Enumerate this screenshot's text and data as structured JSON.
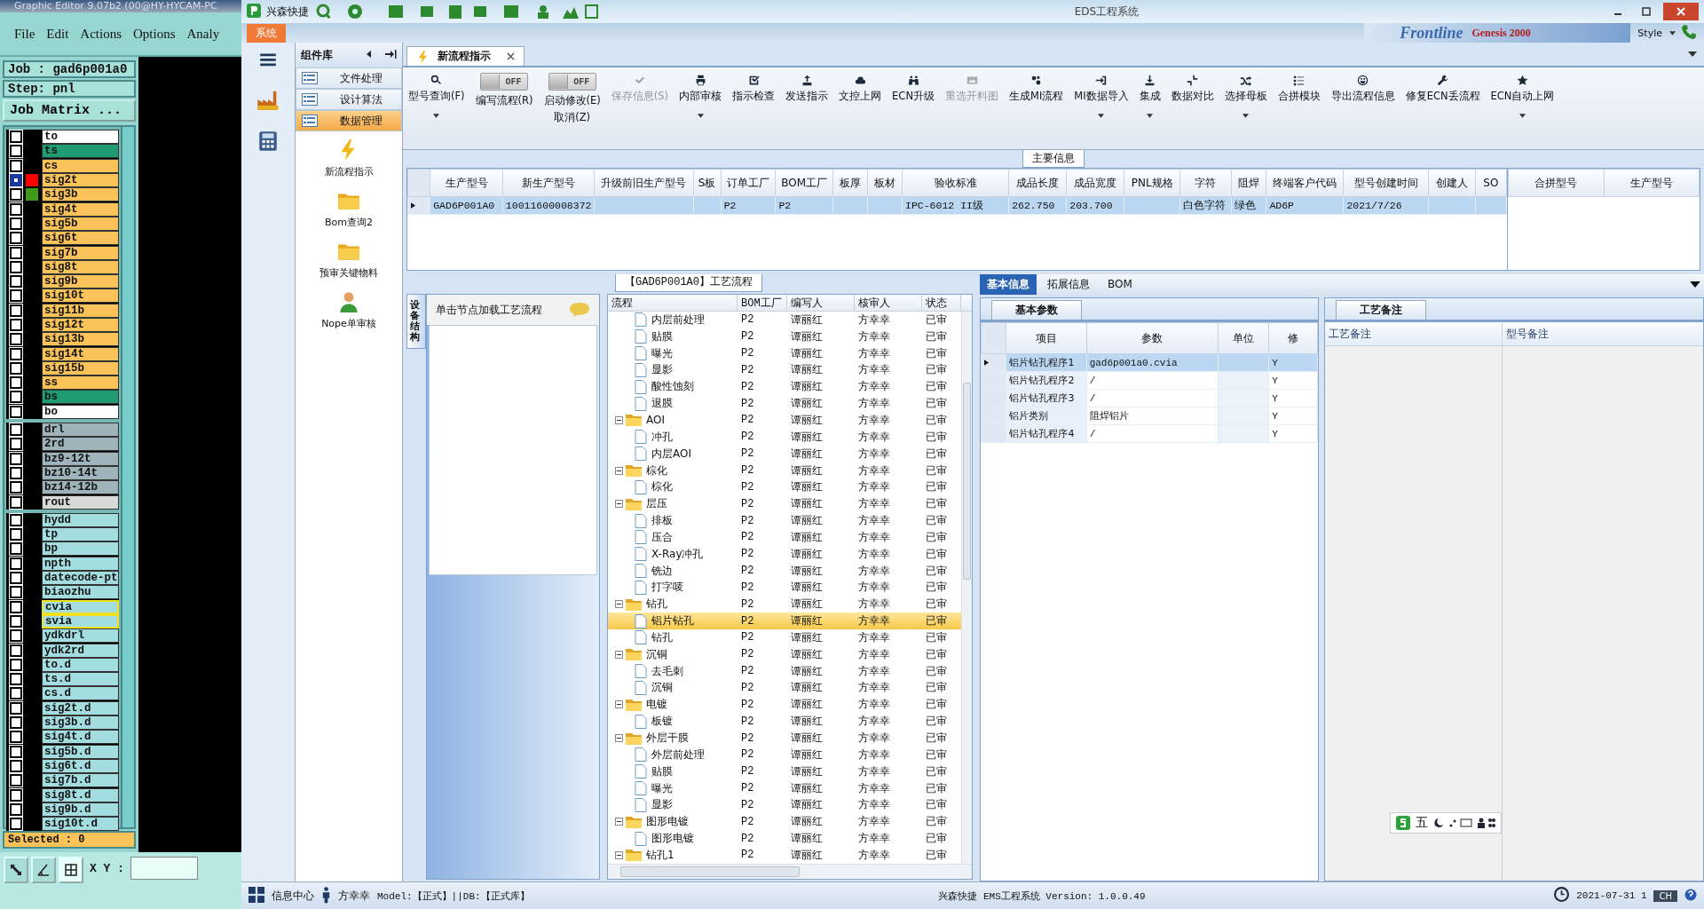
{
  "genesis": {
    "title": "Graphic Editor 9.07b2 (00@HY-HYCAM-PC",
    "menu": [
      "File",
      "Edit",
      "Actions",
      "Options",
      "Analy"
    ],
    "job": "Job : gad6p001a0",
    "step": "Step: pnl",
    "job_matrix": "Job Matrix ...",
    "layer_groups": [
      [
        {
          "name": "to",
          "color": "#ffffff",
          "checked": false,
          "highlighted": false
        },
        {
          "name": "ts",
          "color": "#1f9c72",
          "checked": false,
          "highlighted": false
        },
        {
          "name": "cs",
          "color": "#f9c35a",
          "checked": false,
          "highlighted": false
        },
        {
          "name": "sig2t",
          "color": "#f9c35a",
          "swatch": {
            "color": "#ff0000"
          },
          "checked": true,
          "highlighted": false
        },
        {
          "name": "sig3b",
          "color": "#f9c35a",
          "swatch": {
            "color": "#3f9a1c"
          },
          "checked": false,
          "highlighted": false
        },
        {
          "name": "sig4t",
          "color": "#f9c35a",
          "checked": false,
          "highlighted": false
        },
        {
          "name": "sig5b",
          "color": "#f9c35a",
          "checked": false,
          "highlighted": false
        },
        {
          "name": "sig6t",
          "color": "#f9c35a",
          "checked": false,
          "highlighted": false
        },
        {
          "name": "sig7b",
          "color": "#f9c35a",
          "checked": false,
          "highlighted": false
        },
        {
          "name": "sig8t",
          "color": "#f9c35a",
          "checked": false,
          "highlighted": false
        },
        {
          "name": "sig9b",
          "color": "#f9c35a",
          "checked": false,
          "highlighted": false
        },
        {
          "name": "sig10t",
          "color": "#f9c35a",
          "checked": false,
          "highlighted": false
        },
        {
          "name": "sig11b",
          "color": "#f9c35a",
          "checked": false,
          "highlighted": false
        },
        {
          "name": "sig12t",
          "color": "#f9c35a",
          "checked": false,
          "highlighted": false
        },
        {
          "name": "sig13b",
          "color": "#f9c35a",
          "checked": false,
          "highlighted": false
        },
        {
          "name": "sig14t",
          "color": "#f9c35a",
          "checked": false,
          "highlighted": false
        },
        {
          "name": "sig15b",
          "color": "#f9c35a",
          "checked": false,
          "highlighted": false
        },
        {
          "name": "ss",
          "color": "#f9c35a",
          "checked": false,
          "highlighted": false
        },
        {
          "name": "bs",
          "color": "#1f9c72",
          "checked": false,
          "highlighted": false
        },
        {
          "name": "bo",
          "color": "#ffffff",
          "checked": false,
          "highlighted": false
        }
      ],
      [
        {
          "name": "drl",
          "color": "#9fb3bb",
          "checked": false,
          "highlighted": false
        },
        {
          "name": "2rd",
          "color": "#9fb3bb",
          "checked": false,
          "highlighted": false
        },
        {
          "name": "bz9-12t",
          "color": "#9fb3bb",
          "checked": false,
          "highlighted": false
        },
        {
          "name": "bz10-14t",
          "color": "#9fb3bb",
          "checked": false,
          "highlighted": false
        },
        {
          "name": "bz14-12b",
          "color": "#9fb3bb",
          "checked": false,
          "highlighted": false
        },
        {
          "name": "rout",
          "color": "#d9d9d9",
          "checked": false,
          "highlighted": false
        }
      ],
      [
        {
          "name": "hydd",
          "color": "#a3dde0",
          "checked": false,
          "highlighted": false
        },
        {
          "name": "tp",
          "color": "#a3dde0",
          "checked": false,
          "highlighted": false
        },
        {
          "name": "bp",
          "color": "#a3dde0",
          "checked": false,
          "highlighted": false
        },
        {
          "name": "npth",
          "color": "#a3dde0",
          "checked": false,
          "highlighted": false
        },
        {
          "name": "datecode-pt",
          "color": "#a3dde0",
          "checked": false,
          "highlighted": false
        },
        {
          "name": "biaozhu",
          "color": "#a3dde0",
          "checked": false,
          "highlighted": false
        },
        {
          "name": "cvia",
          "color": "#a3dde0",
          "checked": false,
          "highlighted": true
        },
        {
          "name": "svia",
          "color": "#a3dde0",
          "checked": false,
          "highlighted": true
        },
        {
          "name": "ydkdrl",
          "color": "#a3dde0",
          "checked": false,
          "highlighted": false
        },
        {
          "name": "ydk2rd",
          "color": "#a3dde0",
          "checked": false,
          "highlighted": false
        },
        {
          "name": "to.d",
          "color": "#a3dde0",
          "checked": false,
          "highlighted": false
        },
        {
          "name": "ts.d",
          "color": "#a3dde0",
          "checked": false,
          "highlighted": false
        },
        {
          "name": "cs.d",
          "color": "#a3dde0",
          "checked": false,
          "highlighted": false
        },
        {
          "name": "sig2t.d",
          "color": "#a3dde0",
          "checked": false,
          "highlighted": false
        },
        {
          "name": "sig3b.d",
          "color": "#a3dde0",
          "checked": false,
          "highlighted": false
        },
        {
          "name": "sig4t.d",
          "color": "#a3dde0",
          "checked": false,
          "highlighted": false
        },
        {
          "name": "sig5b.d",
          "color": "#a3dde0",
          "checked": false,
          "highlighted": false
        },
        {
          "name": "sig6t.d",
          "color": "#a3dde0",
          "checked": false,
          "highlighted": false
        },
        {
          "name": "sig7b.d",
          "color": "#a3dde0",
          "checked": false,
          "highlighted": false
        },
        {
          "name": "sig8t.d",
          "color": "#a3dde0",
          "checked": false,
          "highlighted": false
        },
        {
          "name": "sig9b.d",
          "color": "#a3dde0",
          "checked": false,
          "highlighted": false
        },
        {
          "name": "sig10t.d",
          "color": "#a3dde0",
          "checked": false,
          "highlighted": false
        }
      ]
    ],
    "selected": "Selected : 0",
    "xy_label": "X Y :"
  },
  "ems": {
    "app_name": "兴森快捷",
    "title": "EDS工程系统",
    "menu_tab": "系统",
    "banner": [
      "Frontline",
      "Genesis 2000"
    ],
    "style": "Style",
    "library": {
      "title": "组件库",
      "categories": [
        {
          "label": "文件处理",
          "selected": false
        },
        {
          "label": "设计算法",
          "selected": false
        },
        {
          "label": "数据管理",
          "selected": true
        }
      ],
      "tools": [
        {
          "label": "新流程指示",
          "kind": "lightning"
        },
        {
          "label": "Bom查询2",
          "kind": "folder"
        },
        {
          "label": "预审关键物料",
          "kind": "folder"
        },
        {
          "label": "Nope单审核",
          "kind": "person"
        }
      ]
    },
    "doc_tab": "新流程指示",
    "toolbar": [
      {
        "kind": "button",
        "label": "型号查询(F)",
        "dropdown": true,
        "disabled": false
      },
      {
        "kind": "toggle",
        "state": "OFF",
        "on": false,
        "label": "编写流程(R)"
      },
      {
        "kind": "toggle",
        "state": "OFF",
        "on": false,
        "label": "启动修改(E)",
        "label2": "取消(Z)"
      },
      {
        "kind": "button",
        "label": "保存信息(S)",
        "dropdown": false,
        "disabled": true
      },
      {
        "kind": "button",
        "label": "内部审核",
        "dropdown": true,
        "disabled": false
      },
      {
        "kind": "button",
        "label": "指示检查",
        "dropdown": false,
        "disabled": false
      },
      {
        "kind": "button",
        "label": "发送指示",
        "dropdown": false,
        "disabled": false
      },
      {
        "kind": "button",
        "label": "文控上网",
        "dropdown": false,
        "disabled": false
      },
      {
        "kind": "button",
        "label": "ECN升级",
        "dropdown": false,
        "disabled": false
      },
      {
        "kind": "button",
        "label": "重选开料图",
        "dropdown": false,
        "disabled": true
      },
      {
        "kind": "button",
        "label": "生成MI流程",
        "dropdown": false,
        "disabled": false
      },
      {
        "kind": "button",
        "label": "MI数据导入",
        "dropdown": true,
        "disabled": false
      },
      {
        "kind": "button",
        "label": "集成",
        "dropdown": true,
        "disabled": false
      },
      {
        "kind": "button",
        "label": "数据对比",
        "dropdown": false,
        "disabled": false
      },
      {
        "kind": "button",
        "label": "选择母板",
        "dropdown": true,
        "disabled": false
      },
      {
        "kind": "button",
        "label": "合拼模块",
        "dropdown": false,
        "disabled": false
      },
      {
        "kind": "button",
        "label": "导出流程信息",
        "dropdown": false,
        "disabled": false
      },
      {
        "kind": "button",
        "label": "修复ECN丢流程",
        "dropdown": false,
        "disabled": false
      },
      {
        "kind": "button",
        "label": "ECN自动上网",
        "dropdown": true,
        "disabled": false
      }
    ],
    "main_info": {
      "title": "主要信息",
      "columns": [
        "生产型号",
        "新生产型号",
        "升级前旧生产型号",
        "S板",
        "订单工厂",
        "BOM工厂",
        "板厚",
        "板材",
        "验收标准",
        "成品长度",
        "成品宽度",
        "PNL规格",
        "字符",
        "阻焊",
        "终端客户代码",
        "型号创建时间",
        "创建人",
        "SO"
      ],
      "rows": [
        {
          "selected": true,
          "cells": [
            "GAD6P001A0",
            "10011600008372",
            null,
            null,
            "P2",
            "P2",
            null,
            null,
            "IPC-6012 II级",
            "262.750",
            "203.700",
            null,
            "白色字符",
            "绿色",
            "AD6P",
            "2021/7/26",
            null,
            null
          ]
        }
      ],
      "side_columns": [
        "合拼型号",
        "生产型号"
      ]
    },
    "process": {
      "title": "【GAD6P001A0】工艺流程",
      "side_tab": "设备结构",
      "hint": "单击节点加载工艺流程",
      "columns": [
        "流程",
        "BOM工厂",
        "编写人",
        "核审人",
        "状态"
      ],
      "tree": [
        {
          "kind": "hidden_parent",
          "children": [
            {
              "kind": "file",
              "label": "内层前处理",
              "selected": false,
              "cells": [
                "P2",
                "谭丽红",
                "方幸幸",
                "已审"
              ]
            },
            {
              "kind": "file",
              "label": "贴膜",
              "selected": false,
              "cells": [
                "P2",
                "谭丽红",
                "方幸幸",
                "已审"
              ]
            },
            {
              "kind": "file",
              "label": "曝光",
              "selected": false,
              "cells": [
                "P2",
                "谭丽红",
                "方幸幸",
                "已审"
              ]
            },
            {
              "kind": "file",
              "label": "显影",
              "selected": false,
              "cells": [
                "P2",
                "谭丽红",
                "方幸幸",
                "已审"
              ]
            },
            {
              "kind": "file",
              "label": "酸性蚀刻",
              "selected": false,
              "cells": [
                "P2",
                "谭丽红",
                "方幸幸",
                "已审"
              ]
            },
            {
              "kind": "file",
              "label": "退膜",
              "selected": false,
              "cells": [
                "P2",
                "谭丽红",
                "方幸幸",
                "已审"
              ]
            }
          ]
        },
        {
          "kind": "folder",
          "label": "AOI",
          "expanded": true,
          "selected": false,
          "cells": [
            "P2",
            "谭丽红",
            "方幸幸",
            "已审"
          ],
          "children": [
            {
              "kind": "file",
              "label": "冲孔",
              "selected": false,
              "cells": [
                "P2",
                "谭丽红",
                "方幸幸",
                "已审"
              ]
            },
            {
              "kind": "file",
              "label": "内层AOI",
              "selected": false,
              "cells": [
                "P2",
                "谭丽红",
                "方幸幸",
                "已审"
              ]
            }
          ]
        },
        {
          "kind": "folder",
          "label": "棕化",
          "expanded": true,
          "selected": false,
          "cells": [
            "P2",
            "谭丽红",
            "方幸幸",
            "已审"
          ],
          "children": [
            {
              "kind": "file",
              "label": "棕化",
              "selected": false,
              "cells": [
                "P2",
                "谭丽红",
                "方幸幸",
                "已审"
              ]
            }
          ]
        },
        {
          "kind": "folder",
          "label": "层压",
          "expanded": true,
          "selected": false,
          "cells": [
            "P2",
            "谭丽红",
            "方幸幸",
            "已审"
          ],
          "children": [
            {
              "kind": "file",
              "label": "排板",
              "selected": false,
              "cells": [
                "P2",
                "谭丽红",
                "方幸幸",
                "已审"
              ]
            },
            {
              "kind": "file",
              "label": "压合",
              "selected": false,
              "cells": [
                "P2",
                "谭丽红",
                "方幸幸",
                "已审"
              ]
            },
            {
              "kind": "file",
              "label": "X-Ray冲孔",
              "selected": false,
              "cells": [
                "P2",
                "谭丽红",
                "方幸幸",
                "已审"
              ]
            },
            {
              "kind": "file",
              "label": "铣边",
              "selected": false,
              "cells": [
                "P2",
                "谭丽红",
                "方幸幸",
                "已审"
              ]
            },
            {
              "kind": "file",
              "label": "打字唛",
              "selected": false,
              "cells": [
                "P2",
                "谭丽红",
                "方幸幸",
                "已审"
              ]
            }
          ]
        },
        {
          "kind": "folder",
          "label": "钻孔",
          "expanded": true,
          "selected": false,
          "cells": [
            "P2",
            "谭丽红",
            "方幸幸",
            "已审"
          ],
          "children": [
            {
              "kind": "file",
              "label": "铝片钻孔",
              "selected": true,
              "cells": [
                "P2",
                "谭丽红",
                "方幸幸",
                "已审"
              ]
            },
            {
              "kind": "file",
              "label": "钻孔",
              "selected": false,
              "cells": [
                "P2",
                "谭丽红",
                "方幸幸",
                "已审"
              ]
            }
          ]
        },
        {
          "kind": "folder",
          "label": "沉铜",
          "expanded": true,
          "selected": false,
          "cells": [
            "P2",
            "谭丽红",
            "方幸幸",
            "已审"
          ],
          "children": [
            {
              "kind": "file",
              "label": "去毛刺",
              "selected": false,
              "cells": [
                "P2",
                "谭丽红",
                "方幸幸",
                "已审"
              ]
            },
            {
              "kind": "file",
              "label": "沉铜",
              "selected": false,
              "cells": [
                "P2",
                "谭丽红",
                "方幸幸",
                "已审"
              ]
            }
          ]
        },
        {
          "kind": "folder",
          "label": "电镀",
          "expanded": true,
          "selected": false,
          "cells": [
            "P2",
            "谭丽红",
            "方幸幸",
            "已审"
          ],
          "children": [
            {
              "kind": "file",
              "label": "板镀",
              "selected": false,
              "cells": [
                "P2",
                "谭丽红",
                "方幸幸",
                "已审"
              ]
            }
          ]
        },
        {
          "kind": "folder",
          "label": "外层干膜",
          "expanded": true,
          "selected": false,
          "cells": [
            "P2",
            "谭丽红",
            "方幸幸",
            "已审"
          ],
          "children": [
            {
              "kind": "file",
              "label": "外层前处理",
              "selected": false,
              "cells": [
                "P2",
                "谭丽红",
                "方幸幸",
                "已审"
              ]
            },
            {
              "kind": "file",
              "label": "贴膜",
              "selected": false,
              "cells": [
                "P2",
                "谭丽红",
                "方幸幸",
                "已审"
              ]
            },
            {
              "kind": "file",
              "label": "曝光",
              "selected": false,
              "cells": [
                "P2",
                "谭丽红",
                "方幸幸",
                "已审"
              ]
            },
            {
              "kind": "file",
              "label": "显影",
              "selected": false,
              "cells": [
                "P2",
                "谭丽红",
                "方幸幸",
                "已审"
              ]
            }
          ]
        },
        {
          "kind": "folder",
          "label": "图形电镀",
          "expanded": true,
          "selected": false,
          "cells": [
            "P2",
            "谭丽红",
            "方幸幸",
            "已审"
          ],
          "children": [
            {
              "kind": "file",
              "label": "图形电镀",
              "selected": false,
              "cells": [
                "P2",
                "谭丽红",
                "方幸幸",
                "已审"
              ]
            }
          ]
        },
        {
          "kind": "folder",
          "label": "钻孔1",
          "expanded": true,
          "selected": false,
          "cells": [
            "P2",
            "谭丽红",
            "方幸幸",
            "已审"
          ]
        }
      ]
    },
    "detail": {
      "tabs": [
        {
          "label": "基本信息",
          "selected": true
        },
        {
          "label": "拓展信息",
          "selected": false
        },
        {
          "label": "BOM",
          "selected": false
        }
      ],
      "params": {
        "tab": "基本参数",
        "columns": [
          "项目",
          "参数",
          "单位",
          "修"
        ],
        "rows": [
          {
            "selected": true,
            "cells": [
              "铝片钻孔程序1",
              "gad6p001a0.cvia",
              null,
              "Y"
            ]
          },
          {
            "selected": false,
            "cells": [
              "铝片钻孔程序2",
              "/",
              null,
              "Y"
            ]
          },
          {
            "selected": false,
            "cells": [
              "铝片钻孔程序3",
              "/",
              null,
              "Y"
            ]
          },
          {
            "selected": false,
            "cells": [
              "铝片类别",
              "阻焊铝片",
              null,
              "Y"
            ]
          },
          {
            "selected": false,
            "cells": [
              "铝片钻孔程序4",
              "/",
              null,
              "Y"
            ]
          }
        ]
      },
      "notes": {
        "tab": "工艺备注",
        "columns": [
          "工艺备注",
          "型号备注"
        ]
      }
    },
    "ime": {
      "label": "五"
    },
    "status": {
      "info": "信息中心",
      "user": "方幸幸",
      "model": "Model:【正式】||DB:【正式库】",
      "version": "兴森快捷 EMS工程系统 Version: 1.0.0.49",
      "date": "2021-07-31 1",
      "lang": "CH"
    }
  }
}
